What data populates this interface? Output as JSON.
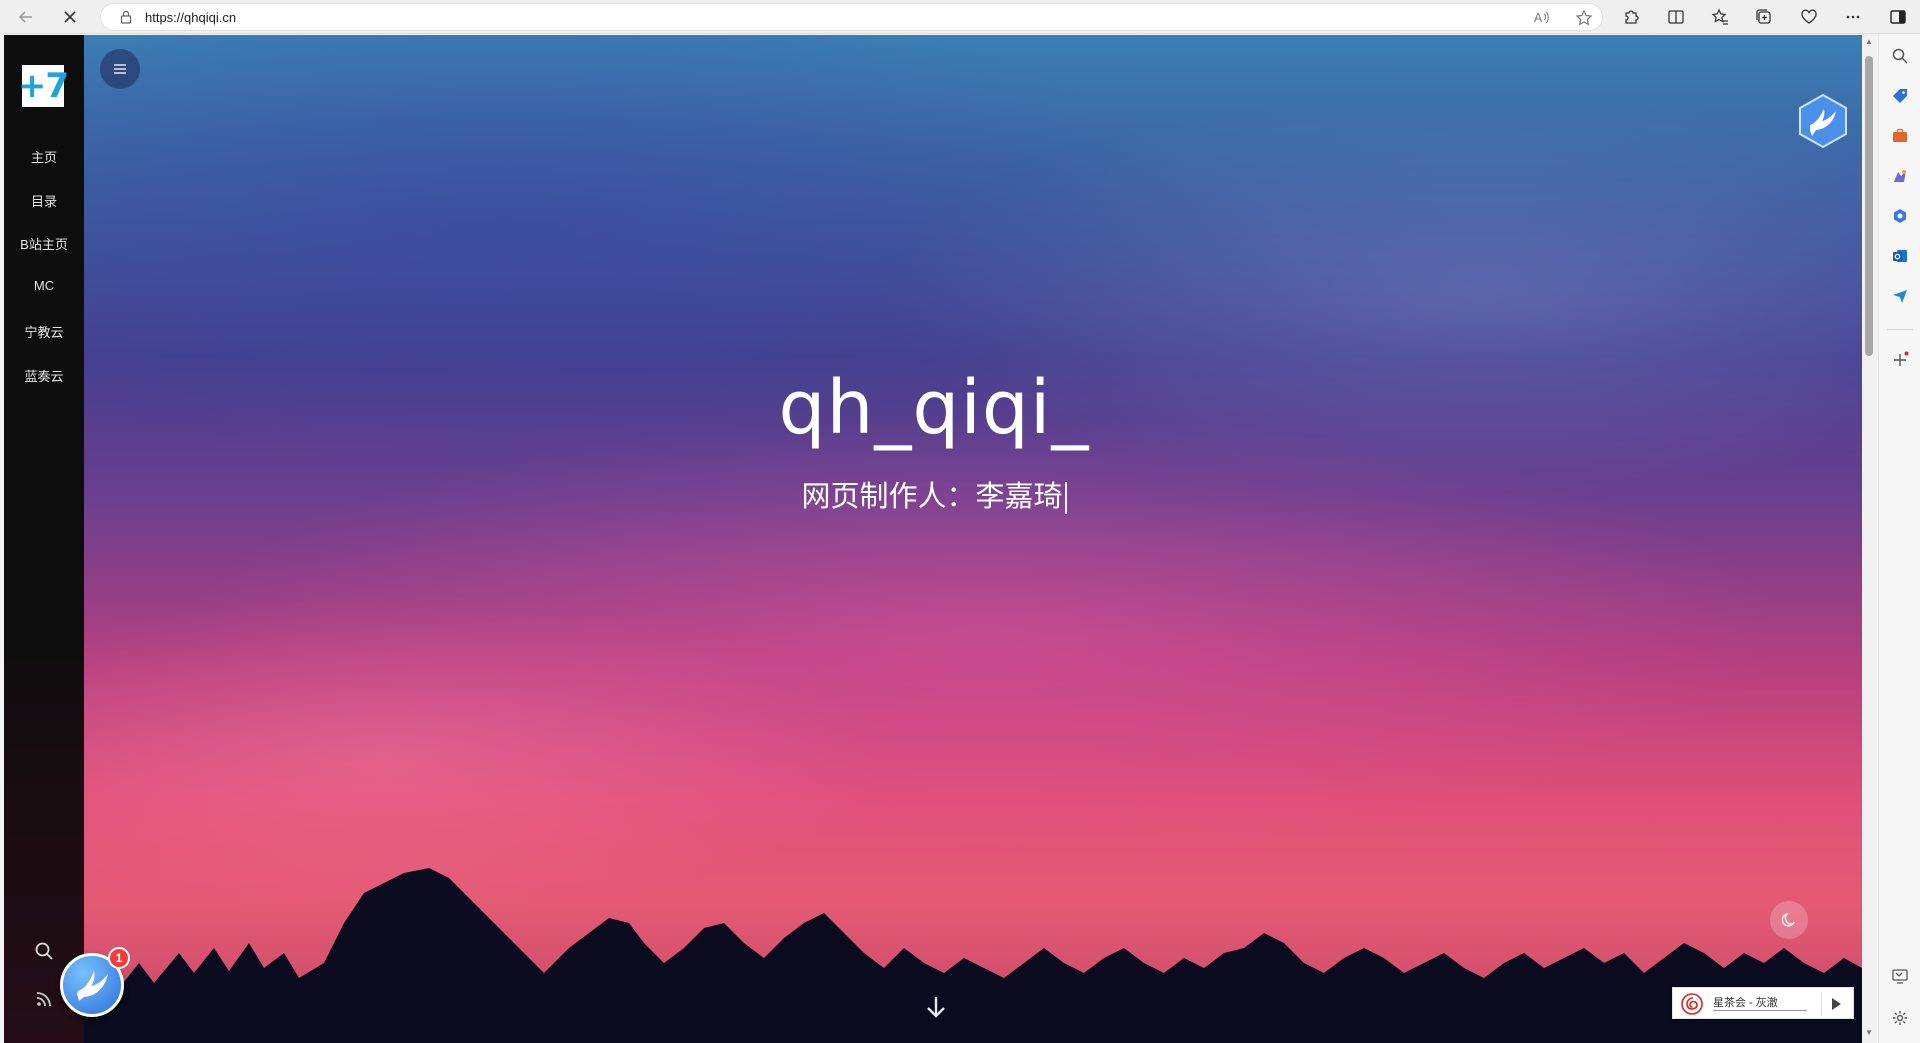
{
  "browser": {
    "url": "https://qhqiqi.cn"
  },
  "sidebar": {
    "logo_text": "+7",
    "items": [
      {
        "label": "主页"
      },
      {
        "label": "目录"
      },
      {
        "label": "B站主页"
      },
      {
        "label": "MC"
      },
      {
        "label": "宁教云"
      },
      {
        "label": "蓝奏云"
      }
    ]
  },
  "hero": {
    "title": "qh_qiqi_",
    "subtitle": "网页制作人：李嘉琦"
  },
  "notification": {
    "count": "1"
  },
  "music_player": {
    "song": "星茶会 - 灰澈"
  },
  "colors": {
    "accent_blue": "#1fa3d9",
    "badge_red": "#f23b3b"
  }
}
